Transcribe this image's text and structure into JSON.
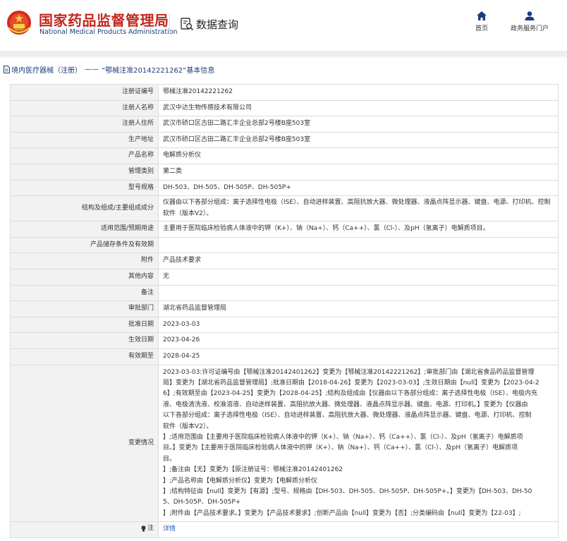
{
  "header": {
    "org_name_cn": "国家药品监督管理局",
    "org_name_en": "National Medical Products Administration",
    "section_title": "数据查询",
    "nav_home": "首页",
    "nav_gov": "政务服务门户"
  },
  "breadcrumb": {
    "category": "境内医疗器械（注册）",
    "separator": "——",
    "record": "“鄂械注准20142221262”基本信息"
  },
  "rows": [
    {
      "label": "注册证编号",
      "value": "鄂械注准20142221262"
    },
    {
      "label": "注册人名称",
      "value": "武汉中达生物传感技术有限公司"
    },
    {
      "label": "注册人住所",
      "value": "武汉市硚口区古田二路汇丰企业总部2号楼B座503室"
    },
    {
      "label": "生产地址",
      "value": "武汉市硚口区古田二路汇丰企业总部2号楼B座503室"
    },
    {
      "label": "产品名称",
      "value": "电解质分析仪"
    },
    {
      "label": "管理类别",
      "value": "第二类"
    },
    {
      "label": "型号规格",
      "value": "DH-503、DH-505、DH-505P、DH-505P+"
    },
    {
      "label": "结构及组成/主要组成成分",
      "value": "仪器由以下各部分组成：离子选择性电极（ISE）、自动进样装置、高阻抗放大器、微处理器、液晶点阵显示器、键盘、电源、打印机、控制软件（版本V2）。"
    },
    {
      "label": "适用范围/预期用途",
      "value": "主要用于医院临床检验病人体液中的钾（K+）、钠（Na+）、钙（Ca++）、氯（Cl-）、及pH（氢离子）电解质项目。"
    },
    {
      "label": "产品储存条件及有效期",
      "value": ""
    },
    {
      "label": "附件",
      "value": "产品技术要求"
    },
    {
      "label": "其他内容",
      "value": "无"
    },
    {
      "label": "备注",
      "value": ""
    },
    {
      "label": "审批部门",
      "value": "湖北省药品监督管理局"
    },
    {
      "label": "批准日期",
      "value": "2023-03-03"
    },
    {
      "label": "生效日期",
      "value": "2023-04-26"
    },
    {
      "label": "有效期至",
      "value": "2028-04-25"
    }
  ],
  "change": {
    "label": "变更情况",
    "lines": [
      "2023-03-03:许可证编号由【鄂械注准20142401262】变更为【鄂械注准20142221262】;审批部门由【湖北省食品药品监督管理",
      "局】变更为【湖北省药品监督管理局】;批准日期由【2018-04-26】变更为【2023-03-03】;生效日期由【null】变更为【2023-04-2",
      "6】;有效期至由【2023-04-25】变更为【2028-04-25】;结构及组成由【仪器由以下各部分组成：离子选择性电极（ISE）、电极内充",
      "液、电极清洗液、校准溶液、自动进样装置、高阻抗放大器、微处理器、液晶点阵显示器、键盘、电源、打印机。】变更为【仪器由",
      "以下各部分组成：离子选择性电极（ISE）、自动进样装置、高阻抗放大器、微处理器、液晶点阵显示器、键盘、电源、打印机、控制",
      "软件（版本V2）。",
      "】;适用范围由【主要用于医院临床检验病人体液中的钾（K+）、钠（Na+）、钙（Ca++）、氯（Cl-）、及pH（氢离子）电解质项",
      "目。】变更为【主要用于医院临床检验病人体液中的钾（K+）、钠（Na+）、钙（Ca++）、氯（Cl-）、及pH（氢离子）电解质项",
      "目。",
      "】;备注由【无】变更为【原注册证号：鄂械注准20142401262",
      "】;产品名称由【电解质分析仪】变更为【电解质分析仪",
      "】;结构特征由【null】变更为【有源】;型号、规格由【DH-503、DH-505、DH-505P、DH-505P+。】变更为【DH-503、DH-50",
      "5、DH-505P、DH-505P+",
      "】;附件由【产品技术要求。】变更为【产品技术要求】;创新产品由【null】变更为【否】;分类编码由【null】变更为【22-03】;"
    ]
  },
  "note": {
    "label": "注",
    "link_text": "详情"
  },
  "colors": {
    "brand_red": "#c2281c",
    "brand_blue": "#1a3d7c",
    "label_bg": "#f2f2f2",
    "link": "#1a5fb4"
  }
}
